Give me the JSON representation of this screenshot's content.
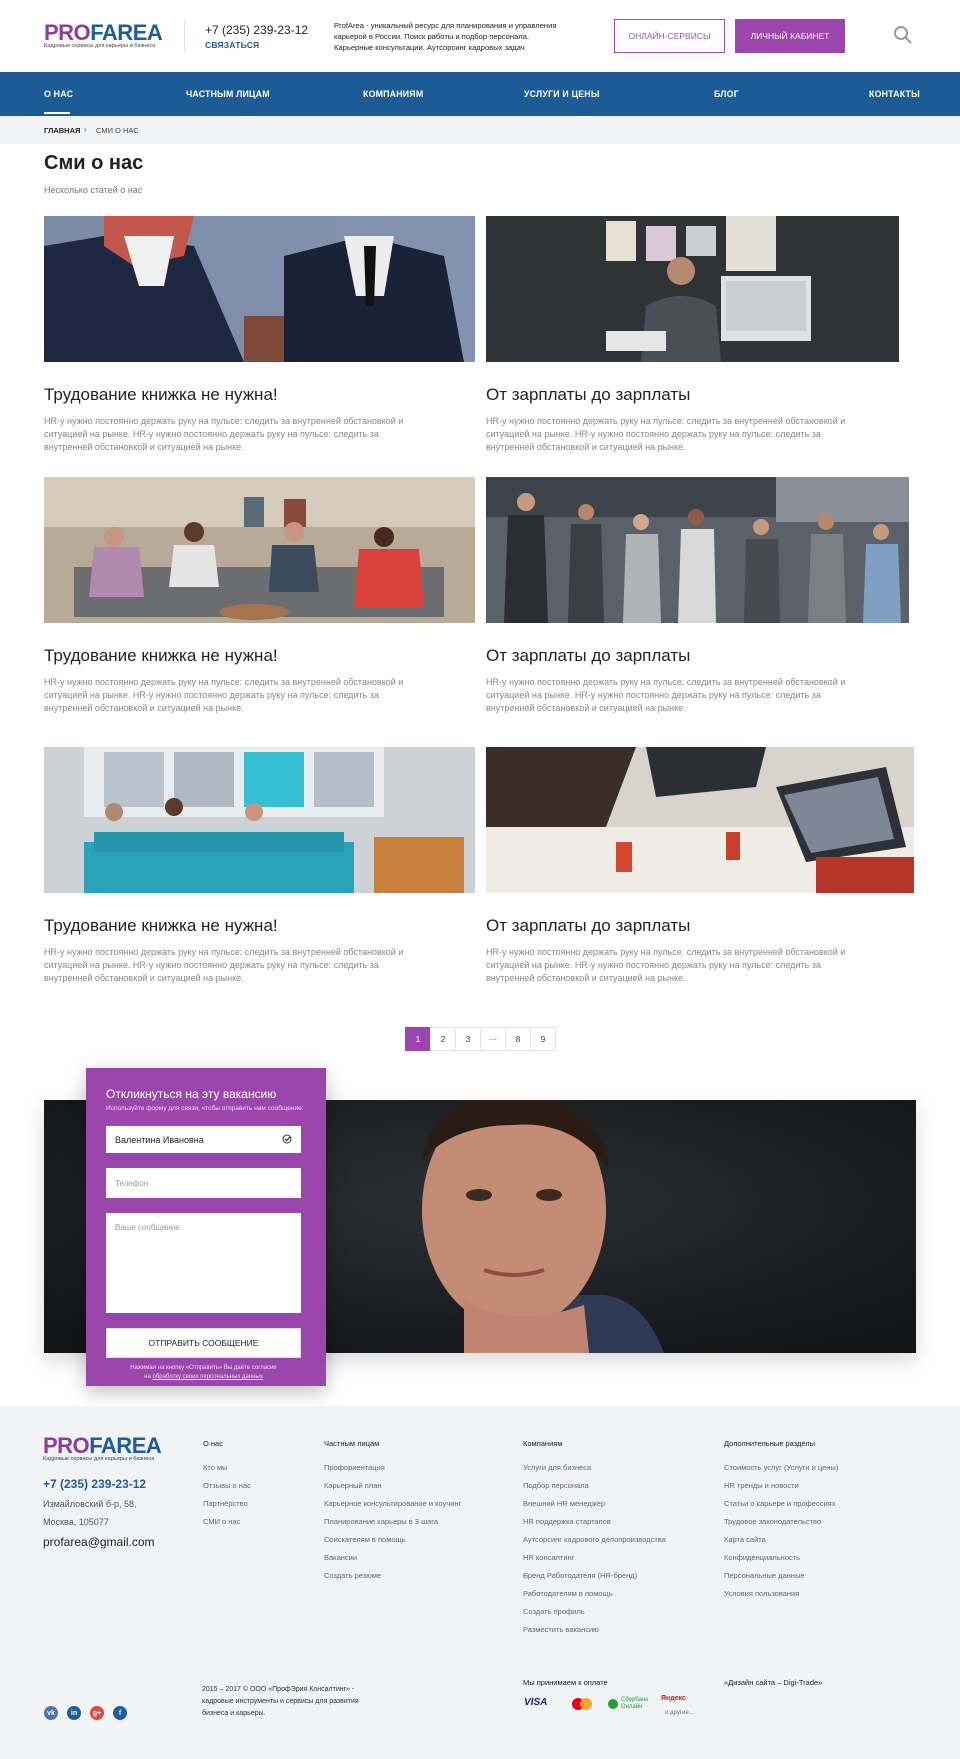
{
  "header": {
    "logo_part1": "PRO",
    "logo_part2": "FAREA",
    "logo_tagline": "Кадровые сервисы для карьеры и бизнеса",
    "phone": "+7 (235) 239-23-12",
    "contact_link": "СВЯЗАТЬСЯ",
    "description": "ProfArea - уникальный ресурс для планирования и управления карьерой в России. Поиск работы и подбор персонала. Карьерные консультации. Аутсорсинг кадровых задач",
    "online_button": "ОНЛАЙН-СЕРВИСЫ",
    "cabinet_button": "ЛИЧНЫЙ КАБИНЕТ"
  },
  "nav": {
    "items": [
      "О НАС",
      "ЧАСТНЫМ ЛИЦАМ",
      "КОМПАНИЯМ",
      "УСЛУГИ И ЦЕНЫ",
      "БЛОГ",
      "КОНТАКТЫ"
    ]
  },
  "breadcrumb": {
    "home": "ГЛАВНАЯ",
    "separator": "›",
    "current": "СМИ О НАС"
  },
  "page": {
    "title": "Сми о нас",
    "subtitle": "Несколько статей о нас"
  },
  "articles": [
    {
      "title": "Трудование книжка не нужна!",
      "text": "HR-у нужно постоянно держать руку на пульсе: следить за внутренней обстановкой и ситуацией на рынке. HR-у нужно постоянно держать руку на пульсе: следить за внутренней обстановкой и ситуацией на рынке."
    },
    {
      "title": "От зарплаты до зарплаты",
      "text": "HR-у нужно постоянно держать руку на пульсе: следить за внутренней обстановкой и ситуацией на рынке. HR-у нужно постоянно держать руку на пульсе: следить за внутренней обстановкой и ситуацией на рынке."
    },
    {
      "title": "Трудование книжка не нужна!",
      "text": "HR-у нужно постоянно держать руку на пульсе: следить за внутренней обстановкой и ситуацией на рынке. HR-у нужно постоянно держать руку на пульсе: следить за внутренней обстановкой и ситуацией на рынке."
    },
    {
      "title": "От зарплаты до зарплаты",
      "text": "HR-у нужно постоянно держать руку на пульсе: следить за внутренней обстановкой и ситуацией на рынке. HR-у нужно постоянно держать руку на пульсе: следить за внутренней обстановкой и ситуацией на рынке."
    },
    {
      "title": "Трудование книжка не нужна!",
      "text": "HR-у нужно постоянно держать руку на пульсе: следить за внутренней обстановкой и ситуацией на рынке. HR-у нужно постоянно держать руку на пульсе: следить за внутренней обстановкой и ситуацией на рынке."
    },
    {
      "title": "От зарплаты до зарплаты",
      "text": "HR-у нужно постоянно держать руку на пульсе: следить за внутренней обстановкой и ситуацией на рынке. HR-у нужно постоянно держать руку на пульсе: следить за внутренней обстановкой и ситуацией на рынке."
    }
  ],
  "pagination": [
    "1",
    "2",
    "3",
    "···",
    "8",
    "9"
  ],
  "form": {
    "title": "Откликнуться на эту вакансию",
    "subtitle": "Используйте форму для связи, чтобы отправить нам сообщение:",
    "name_value": "Валентина Ивановна",
    "phone_placeholder": "Телефон",
    "message_placeholder": "Ваше сообщение",
    "submit": "ОТПРАВИТЬ СООБЩЕНИЕ",
    "note_line1": "Нажимая на кнопку «Отправить» Вы даёте согласие",
    "note_line2_prefix": "на ",
    "note_link": "обработку своих персональных данных"
  },
  "footer": {
    "phone": "+7 (235) 239-23-12",
    "address_line1": "Измайловский б-р, 58,",
    "address_line2": "Москва, 105077",
    "email": "profarea@gmail.com",
    "columns": [
      {
        "title": "О нас",
        "links": [
          "Кто мы",
          "Отзывы о нас",
          "Партнёрство",
          "СМИ о нас"
        ]
      },
      {
        "title": "Частным лицам",
        "links": [
          "Профориентация",
          "Карьерный план",
          "Карьерное консультирование и коучинг",
          "Планирование карьеры в 3 шага",
          "Соискателям в помощь",
          "Вакансии",
          "Создать резюме"
        ]
      },
      {
        "title": "Компаниям",
        "links": [
          "Услуги для бизнеса",
          "Подбор персонала",
          "Внешний HR менеджер",
          "HR поддержка стартапов",
          "Аутсорсинг кадрового делопроизводства",
          "HR консалтинг",
          "Бренд Работодателя (HR-бренд)",
          "Работодателям в помощь",
          "Создать профиль",
          "Разместить вакансию"
        ]
      },
      {
        "title": "Дополнительные разделы",
        "links": [
          "Стоимость услуг (Услуги и цены)",
          "HR тренды и новости",
          "Статьи о карьере и профессиях",
          "Трудовое законодательство",
          "Карта сайта",
          "Конфиденциальность",
          "Персональные данные",
          "Условия пользования"
        ]
      }
    ],
    "social": [
      "vk",
      "in",
      "g+",
      "f"
    ],
    "copyright": "2015 – 2017 © ООО «ПрофЭрия Консалтинг» - кадровые инструменты и сервисы для развития бизнеса и карьеры.",
    "payment_title": "Мы принимаем к оплате",
    "payments": [
      "VISA",
      "MasterCard",
      "Сбербанк Онлайн",
      "Яндекс"
    ],
    "payments_more": "и другие...",
    "design_credit": "«Дизайн сайта – Digi-Trade»"
  },
  "colors": {
    "brand_purple": "#9b46ad",
    "brand_blue": "#1d5b97"
  }
}
